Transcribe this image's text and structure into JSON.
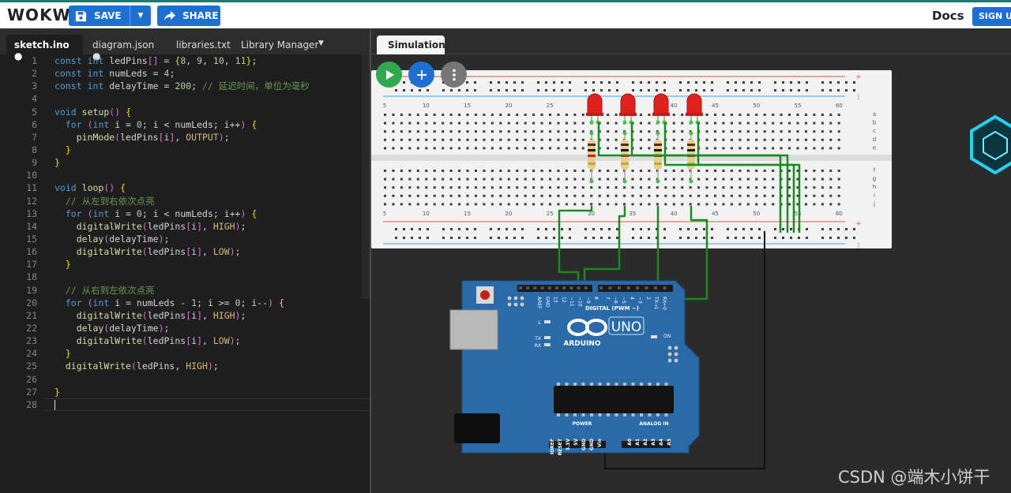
{
  "app": {
    "logo": "WOKWi",
    "save_label": "SAVE",
    "share_label": "SHARE",
    "docs_label": "Docs",
    "signup_label": "SIGN UP"
  },
  "editor": {
    "tabs": [
      {
        "label": "sketch.ino",
        "active": true,
        "modified": true
      },
      {
        "label": "diagram.json",
        "active": false,
        "modified": true
      },
      {
        "label": "libraries.txt",
        "active": false,
        "modified": false
      },
      {
        "label": "Library Manager",
        "active": false,
        "modified": false
      }
    ],
    "lines": [
      "const int ledPins[] = {8, 9, 10, 11};",
      "const int numLeds = 4;",
      "const int delayTime = 200; // 延迟时间，单位为毫秒",
      "",
      "void setup() {",
      "  for (int i = 0; i < numLeds; i++) {",
      "    pinMode(ledPins[i], OUTPUT);",
      "  }",
      "}",
      "",
      "void loop() {",
      "  // 从左到右依次点亮",
      "  for (int i = 0; i < numLeds; i++) {",
      "    digitalWrite(ledPins[i], HIGH);",
      "    delay(delayTime);",
      "    digitalWrite(ledPins[i], LOW);",
      "  }",
      "",
      "  // 从右到左依次点亮",
      "  for (int i = numLeds - 1; i >= 0; i--) {",
      "    digitalWrite(ledPins[i], HIGH);",
      "    delay(delayTime);",
      "    digitalWrite(ledPins[i], LOW);",
      "  }",
      "  digitalWrite(ledPins, HIGH);",
      "",
      "}",
      ""
    ]
  },
  "simulation": {
    "tab_label": "Simulation",
    "breadboard_column_labels": [
      "5",
      "10",
      "15",
      "20",
      "25",
      "30",
      "35",
      "40",
      "45",
      "50",
      "55",
      "60"
    ],
    "breadboard_row_labels_top": [
      "a",
      "b",
      "c",
      "d",
      "e"
    ],
    "breadboard_row_labels_bottom": [
      "f",
      "g",
      "h",
      "i",
      "j"
    ],
    "led_color": "#e0221f",
    "wire_color": "#1a8a25",
    "gnd_wire_color": "#111111",
    "arduino": {
      "brand": "ARDUINO",
      "model": "UNO",
      "digital_label": "DIGITAL (PWM ~)",
      "power_label": "POWER",
      "analog_label": "ANALOG IN",
      "digital_pins": [
        "AREF",
        "GND",
        "13",
        "12",
        "~11",
        "~10",
        "~9",
        "8",
        "7",
        "~6",
        "~5",
        "4",
        "~3",
        "2",
        "TX→1",
        "RX←0"
      ],
      "power_pins": [
        "IOREF",
        "RESET",
        "3.3V",
        "5V",
        "GND",
        "GND",
        "Vin"
      ],
      "analog_pins": [
        "A0",
        "A1",
        "A2",
        "A3",
        "A4",
        "A5"
      ],
      "led_labels": [
        "L",
        "TX",
        "RX",
        "ON"
      ]
    }
  },
  "watermark": "CSDN @端木小饼干"
}
